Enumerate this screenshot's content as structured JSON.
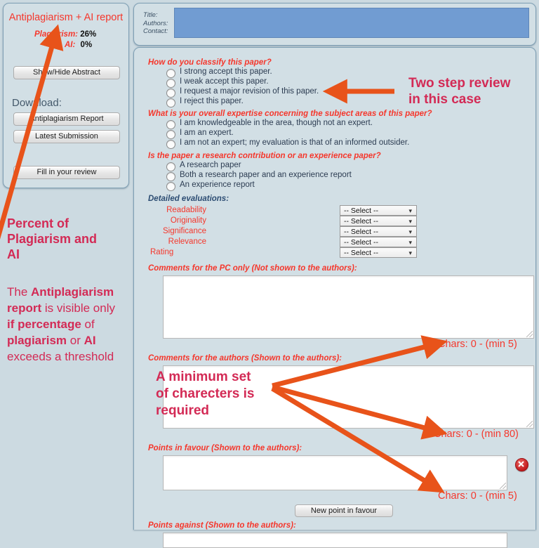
{
  "antiplagiarism_panel": {
    "title": "Antiplagiarism + AI report",
    "plagiarism_label": "Plagiarism:",
    "plagiarism_value": "26%",
    "ai_label": "AI:",
    "ai_value": "0%",
    "abstract_button": "Show/Hide Abstract",
    "download_label": "Download:",
    "report_button": "Antiplagiarism Report",
    "submission_button": "Latest Submission",
    "fill_review_button": "Fill in your review"
  },
  "header": {
    "title_label": "Title:",
    "authors_label": "Authors:",
    "contact_label": "Contact:"
  },
  "form": {
    "classify": {
      "question": "How do you classify this paper?",
      "options": [
        "I strong accept this paper.",
        "I weak accept this paper.",
        "I request a major revision of this paper.",
        "I reject this paper."
      ]
    },
    "expertise": {
      "question": "What is your overall expertise concerning the subject areas of this paper?",
      "options": [
        "I am knowledgeable in the area, though not an expert.",
        "I am an expert.",
        "I am not an expert; my evaluation is that of an informed outsider."
      ]
    },
    "paper_type": {
      "question": "Is the paper a research contribution or an experience paper?",
      "options": [
        "A research paper",
        "Both a research paper and an experience report",
        "An experience report"
      ]
    },
    "detailed_evaluations": {
      "title": "Detailed evaluations:",
      "rows": [
        {
          "label": "Readability",
          "value": "-- Select --"
        },
        {
          "label": "Originality",
          "value": "-- Select --"
        },
        {
          "label": "Significance",
          "value": "-- Select --"
        },
        {
          "label": "Relevance",
          "value": "-- Select --"
        },
        {
          "label": "Rating",
          "value": "-- Select --"
        }
      ]
    },
    "comments_pc": {
      "label": "Comments for the PC only (Not shown to the authors):",
      "value": "",
      "chars": "Chars: 0 - (min 5)"
    },
    "comments_authors": {
      "label": "Comments for the authors (Shown to the authors):",
      "value": "",
      "chars": "Chars: 0 - (min 80)"
    },
    "points_favour": {
      "label": "Points in favour (Shown to the authors):",
      "value": "",
      "chars": "Chars: 0 - (min 5)",
      "new_button": "New point in favour"
    },
    "points_against": {
      "label": "Points against (Shown to the authors):"
    }
  },
  "annotations": {
    "two_step": "Two step review\nin this case",
    "percent_title": "Percent of\nPlagiarism and\nAI",
    "visibility_note_parts": [
      {
        "text": "The ",
        "bold": false
      },
      {
        "text": "Antiplagiarism report",
        "bold": true
      },
      {
        "text": " is visible only ",
        "bold": false
      },
      {
        "text": "if percentage",
        "bold": true
      },
      {
        "text": " of ",
        "bold": false
      },
      {
        "text": "plagiarism",
        "bold": true
      },
      {
        "text": " or ",
        "bold": false
      },
      {
        "text": "AI",
        "bold": true
      },
      {
        "text": " exceeds a threshold",
        "bold": false
      }
    ],
    "minimum_chars": "A minimum set\nof charecters is\nrequired"
  },
  "colors": {
    "page_background": "#ccdae1",
    "panel_background": "#d2dfe5",
    "panel_border": "#7fa0b5",
    "label_red": "#f5372c",
    "section_blue": "#2d4d73",
    "annotation_pink": "#d32a55",
    "arrow_orange": "#e8531a",
    "header_blue_box": "#719cd2",
    "option_text": "#2c3c52"
  }
}
